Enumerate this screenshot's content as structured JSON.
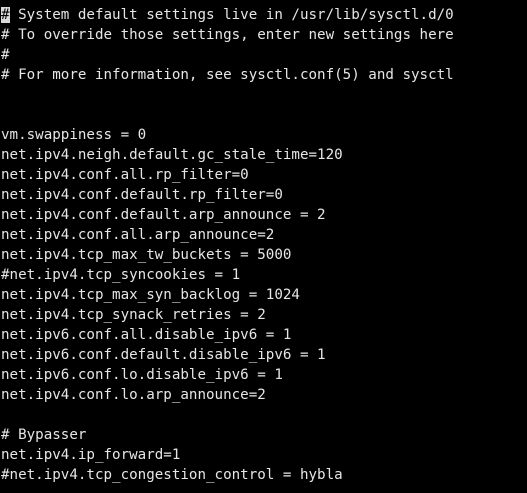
{
  "terminal": {
    "background": "#000000",
    "foreground": "#e6e6e6",
    "cursor_color": "#d9d9d9",
    "cursor_char": "#",
    "first_line_after_cursor": " System default settings live in /usr/lib/sysctl.d/0",
    "lines": [
      "# System default settings live in /usr/lib/sysctl.d/0",
      "# To override those settings, enter new settings here",
      "#",
      "# For more information, see sysctl.conf(5) and sysctl",
      "",
      "",
      "vm.swappiness = 0",
      "net.ipv4.neigh.default.gc_stale_time=120",
      "net.ipv4.conf.all.rp_filter=0",
      "net.ipv4.conf.default.rp_filter=0",
      "net.ipv4.conf.default.arp_announce = 2",
      "net.ipv4.conf.all.arp_announce=2",
      "net.ipv4.tcp_max_tw_buckets = 5000",
      "#net.ipv4.tcp_syncookies = 1",
      "net.ipv4.tcp_max_syn_backlog = 1024",
      "net.ipv4.tcp_synack_retries = 2",
      "net.ipv6.conf.all.disable_ipv6 = 1",
      "net.ipv6.conf.default.disable_ipv6 = 1",
      "net.ipv6.conf.lo.disable_ipv6 = 1",
      "net.ipv4.conf.lo.arp_announce=2",
      "",
      "# Bypasser",
      "net.ipv4.ip_forward=1",
      "#net.ipv4.tcp_congestion_control = hybla"
    ]
  }
}
